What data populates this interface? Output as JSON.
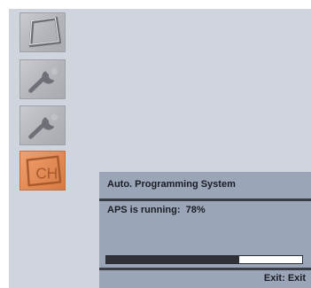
{
  "menu": {
    "items": [
      {
        "icon": "display-icon",
        "active": false
      },
      {
        "icon": "wrench-icon",
        "active": false
      },
      {
        "icon": "wrench-icon",
        "active": false
      },
      {
        "icon": "channel-icon",
        "label": "CH",
        "active": true
      }
    ]
  },
  "dialog": {
    "title": "Auto. Programming System",
    "status_label": "APS is running:",
    "progress_text": "78%",
    "progress_fraction": 0.68,
    "exit_hint": "Exit: Exit"
  },
  "colors": {
    "screen_bg": "#d0d4dd",
    "dialog_bg": "#9aa6b7",
    "active_icon": "#e28a55",
    "progress_fill": "#2e3238"
  }
}
